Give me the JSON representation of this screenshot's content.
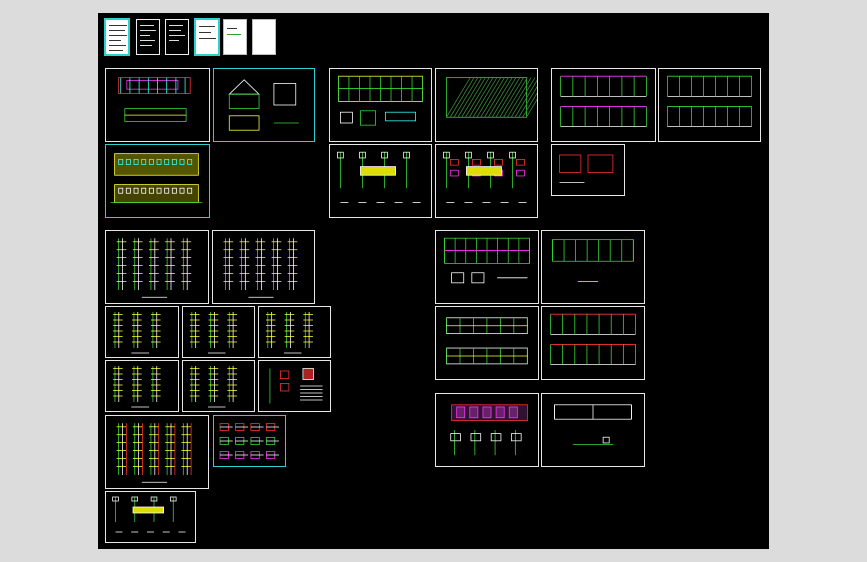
{
  "app": {
    "title": "",
    "background": "#000000",
    "frame_color": "#dcdcdc"
  },
  "colors": {
    "frame": "#e6e6e6",
    "selected": "#2fd0d0",
    "green": "#38d838",
    "yellow": "#ffff33",
    "red": "#ff3333",
    "magenta": "#ff33ff",
    "cyan": "#33ffff",
    "white": "#ffffff"
  },
  "notes": [
    {
      "id": "cover-sheet-1",
      "style": "white-cyan"
    },
    {
      "id": "cover-sheet-2",
      "style": "dark"
    },
    {
      "id": "cover-sheet-3",
      "style": "dark"
    },
    {
      "id": "cover-sheet-4",
      "style": "white-cyan"
    },
    {
      "id": "cover-sheet-5",
      "style": "white"
    },
    {
      "id": "cover-sheet-6",
      "style": "white"
    }
  ],
  "sheets": [
    {
      "id": "arch-plan",
      "kind": "plan-red",
      "selected": false
    },
    {
      "id": "arch-section",
      "kind": "section",
      "selected": true
    },
    {
      "id": "arch-elevation",
      "kind": "elevation-yellow",
      "selected": true
    },
    {
      "id": "struct-grid-plan",
      "kind": "grid-yellow",
      "selected": false
    },
    {
      "id": "struct-hatch-plan",
      "kind": "hatch",
      "selected": false
    },
    {
      "id": "frame-elevation-a",
      "kind": "frame-magenta",
      "selected": false
    },
    {
      "id": "frame-elevation-b",
      "kind": "frame-green",
      "selected": false
    },
    {
      "id": "column-details",
      "kind": "details",
      "selected": false
    },
    {
      "id": "beam-details",
      "kind": "details-color",
      "selected": false
    },
    {
      "id": "small-detail",
      "kind": "small-red",
      "selected": false
    },
    {
      "id": "rebar-cols-1",
      "kind": "columns",
      "selected": false
    },
    {
      "id": "rebar-cols-2",
      "kind": "columns",
      "selected": false
    },
    {
      "id": "rebar-cols-3",
      "kind": "columns",
      "selected": false
    },
    {
      "id": "rebar-cols-4",
      "kind": "columns",
      "selected": false
    },
    {
      "id": "rebar-cols-5",
      "kind": "columns",
      "selected": false
    },
    {
      "id": "rebar-cols-6",
      "kind": "columns",
      "selected": false
    },
    {
      "id": "rebar-cols-7",
      "kind": "columns",
      "selected": false
    },
    {
      "id": "rebar-notes",
      "kind": "notes-red",
      "selected": false
    },
    {
      "id": "rebar-cols-8",
      "kind": "columns-red",
      "selected": false
    },
    {
      "id": "node-details",
      "kind": "nodes",
      "selected": true
    },
    {
      "id": "misc-details",
      "kind": "details",
      "selected": false
    },
    {
      "id": "foundation-plan-a",
      "kind": "grid-green",
      "selected": false
    },
    {
      "id": "foundation-plan-b",
      "kind": "grid-sparse",
      "selected": false
    },
    {
      "id": "roof-framing-a",
      "kind": "truss",
      "selected": false
    },
    {
      "id": "roof-framing-b",
      "kind": "frame-red",
      "selected": false
    },
    {
      "id": "stair-plan",
      "kind": "plan-magenta",
      "selected": false
    },
    {
      "id": "site-section",
      "kind": "section-long",
      "selected": false
    }
  ]
}
